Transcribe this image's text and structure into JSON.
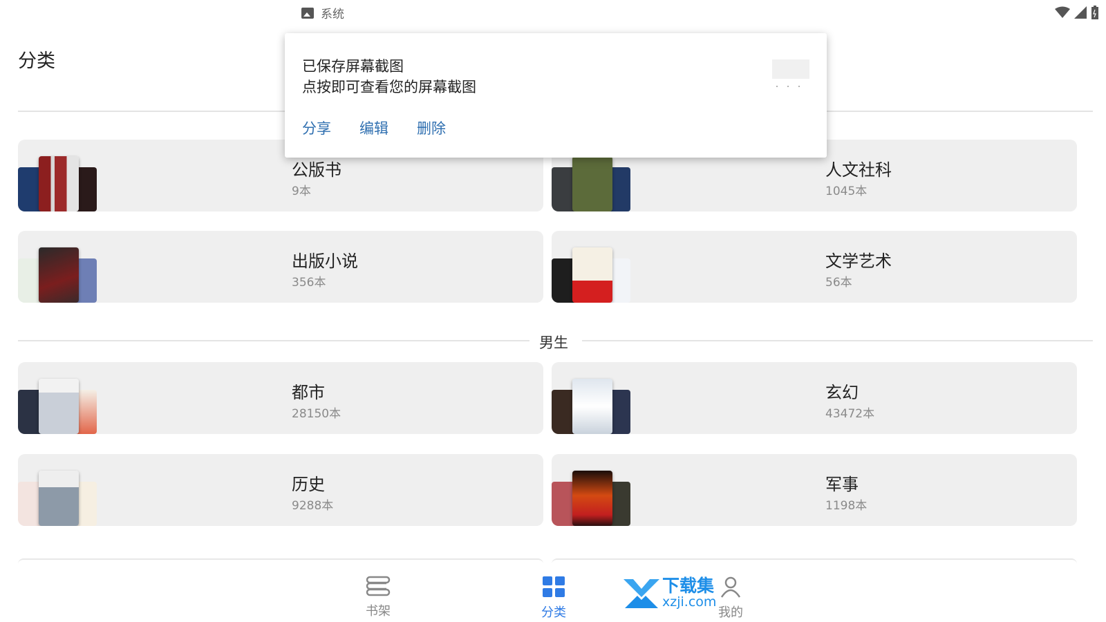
{
  "status_bar": {
    "notification_app": "系统"
  },
  "header": {
    "title": "分类"
  },
  "categories_top": [
    {
      "title": "公版书",
      "count": "9本"
    },
    {
      "title": "人文社科",
      "count": "1045本"
    },
    {
      "title": "出版小说",
      "count": "356本"
    },
    {
      "title": "文学艺术",
      "count": "56本"
    }
  ],
  "section_male": {
    "label": "男生"
  },
  "categories_male": [
    {
      "title": "都市",
      "count": "28150本"
    },
    {
      "title": "玄幻",
      "count": "43472本"
    },
    {
      "title": "历史",
      "count": "9288本"
    },
    {
      "title": "军事",
      "count": "1198本"
    }
  ],
  "notification": {
    "title": "已保存屏幕截图",
    "body": "点按即可查看您的屏幕截图",
    "actions": {
      "share": "分享",
      "edit": "编辑",
      "delete": "删除"
    }
  },
  "bottom_nav": {
    "bookshelf": "书架",
    "categories": "分类",
    "mine": "我的",
    "active_color": "#2f7be5",
    "inactive_color": "#888888"
  },
  "watermark": {
    "line1": "下载集",
    "line2": "xzji.com"
  },
  "colors": {
    "card_bg": "#efefef",
    "accent": "#2f7be5",
    "notif_action": "#2f6fb0"
  },
  "icons": [
    "image-icon",
    "wifi-icon",
    "signal-icon",
    "battery-icon",
    "bookshelf-icon",
    "categories-grid-icon",
    "person-icon"
  ]
}
